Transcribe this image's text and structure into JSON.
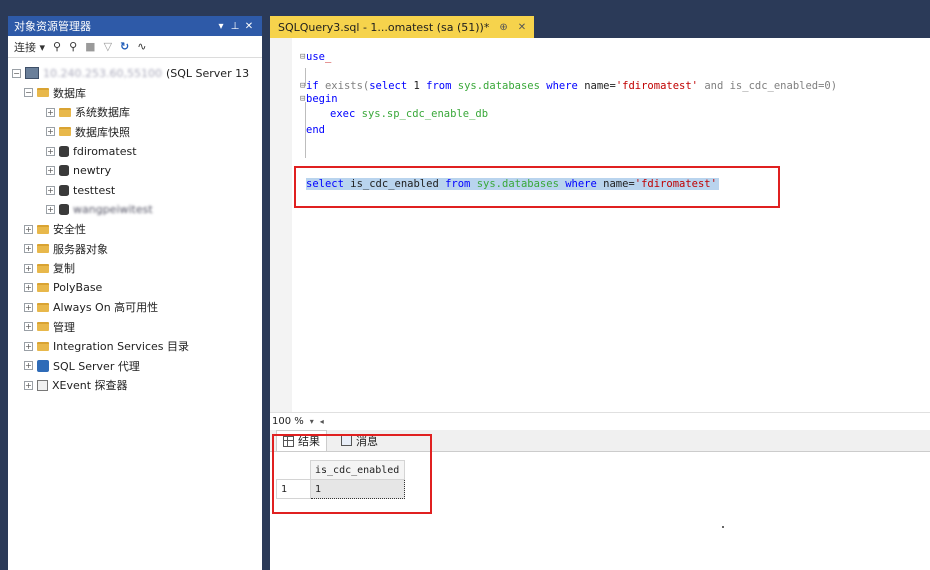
{
  "object_explorer": {
    "title": "对象资源管理器",
    "title_controls": [
      "▾",
      "⊥",
      "✕"
    ],
    "toolbar": {
      "connect_label": "连接 ▾"
    },
    "server_node": "(SQL Server 13",
    "server_blurred": "10.240.253.60,55100",
    "tree": [
      {
        "label": "数据库",
        "level": 1,
        "icon": "folder-icon",
        "expander": "−"
      },
      {
        "label": "系统数据库",
        "level": 2,
        "icon": "folder-icon",
        "expander": "+"
      },
      {
        "label": "数据库快照",
        "level": 2,
        "icon": "folder-icon",
        "expander": "+"
      },
      {
        "label": "fdiromatest",
        "level": 2,
        "icon": "database-icon",
        "expander": "+"
      },
      {
        "label": "newtry",
        "level": 2,
        "icon": "database-icon",
        "expander": "+"
      },
      {
        "label": "testtest",
        "level": 2,
        "icon": "database-icon",
        "expander": "+"
      },
      {
        "label": "wangpeiwitest",
        "level": 2,
        "icon": "database-icon",
        "expander": "+"
      },
      {
        "label": "安全性",
        "level": 1,
        "icon": "folder-icon",
        "expander": "+"
      },
      {
        "label": "服务器对象",
        "level": 1,
        "icon": "folder-icon",
        "expander": "+"
      },
      {
        "label": "复制",
        "level": 1,
        "icon": "folder-icon",
        "expander": "+"
      },
      {
        "label": "PolyBase",
        "level": 1,
        "icon": "folder-icon",
        "expander": "+"
      },
      {
        "label": "Always On 高可用性",
        "level": 1,
        "icon": "folder-icon",
        "expander": "+"
      },
      {
        "label": "管理",
        "level": 1,
        "icon": "folder-icon",
        "expander": "+"
      },
      {
        "label": "Integration Services 目录",
        "level": 1,
        "icon": "folder-icon",
        "expander": "+"
      },
      {
        "label": "SQL Server 代理",
        "level": 1,
        "icon": "agent-icon",
        "expander": "+"
      },
      {
        "label": "XEvent 探查器",
        "level": 1,
        "icon": "xevent-icon",
        "expander": "+"
      }
    ]
  },
  "document": {
    "tab_title": "SQLQuery3.sql - 1...omatest (sa (51))*",
    "tab_pin": "⊕",
    "tab_close": "✕",
    "code": {
      "line1_kw": "use",
      "line2_kw1": "if",
      "line2_a": " exists(",
      "line2_kw2": "select",
      "line2_b": " 1 ",
      "line2_kw3": "from",
      "line2_sys": " sys.databases ",
      "line2_kw4": "where",
      "line2_c": " name=",
      "line2_str": "'fdiromatest'",
      "line2_d": " and is_cdc_enabled=0)",
      "line3_kw": "begin",
      "line4_kw": "exec",
      "line4_sys": " sys.sp_cdc_enable_db",
      "line5_kw": "end",
      "line6_kw1": "select",
      "line6_a": " is_cdc_enabled ",
      "line6_kw2": "from",
      "line6_sys": " sys.databases ",
      "line6_kw3": "where",
      "line6_b": " name=",
      "line6_str": "'fdiromatest'"
    },
    "zoom": "100 %",
    "results_tabs": [
      {
        "label": "结果",
        "icon": "grid-icon",
        "active": true
      },
      {
        "label": "消息",
        "icon": "messages-icon",
        "active": false
      }
    ],
    "grid": {
      "columns": [
        "is_cdc_enabled"
      ],
      "rows": [
        {
          "row_number": "1",
          "values": [
            "1"
          ]
        }
      ]
    }
  }
}
